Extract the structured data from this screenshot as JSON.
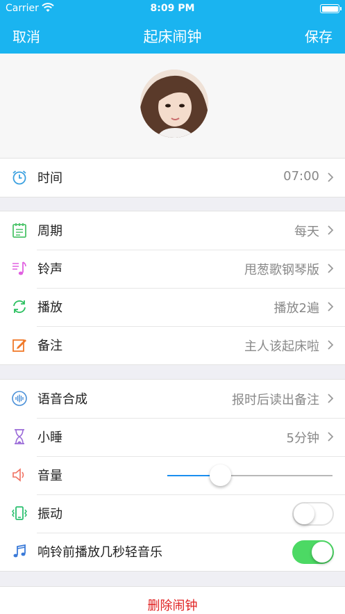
{
  "status_bar": {
    "carrier": "Carrier",
    "time": "8:09 PM"
  },
  "nav": {
    "cancel": "取消",
    "title": "起床闹钟",
    "save": "保存"
  },
  "colors": {
    "header": "#1ab4f0",
    "slider_fill": "#1a8ff0",
    "toggle_on": "#4cd964",
    "delete_text": "#e02020"
  },
  "time_row": {
    "icon": "alarm-clock-icon",
    "label": "时间",
    "value": "07:00"
  },
  "settings": [
    {
      "icon": "calendar-icon",
      "label": "周期",
      "value": "每天"
    },
    {
      "icon": "music-note-icon",
      "label": "铃声",
      "value": "甩葱歌钢琴版"
    },
    {
      "icon": "repeat-icon",
      "label": "播放",
      "value": "播放2遍"
    },
    {
      "icon": "edit-note-icon",
      "label": "备注",
      "value": "主人该起床啦"
    }
  ],
  "options": {
    "voice": {
      "icon": "voice-wave-icon",
      "label": "语音合成",
      "value": "报时后读出备注"
    },
    "snooze": {
      "icon": "hourglass-icon",
      "label": "小睡",
      "value": "5分钟"
    },
    "volume": {
      "icon": "speaker-icon",
      "label": "音量",
      "level": 0.32
    },
    "vibrate": {
      "icon": "vibrate-phone-icon",
      "label": "振动",
      "on": false
    },
    "preplay": {
      "icon": "music-icon",
      "label": "响铃前播放几秒轻音乐",
      "on": true
    }
  },
  "delete_label": "删除闹钟"
}
